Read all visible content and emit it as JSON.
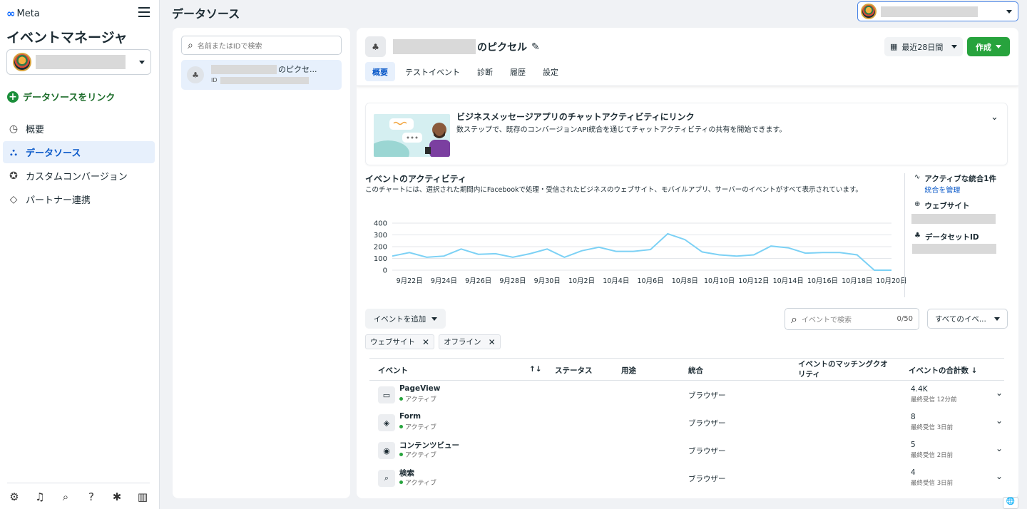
{
  "sidebar": {
    "logo": "Meta",
    "app_title": "イベントマネージャ",
    "link_datasource": "データソースをリンク",
    "nav": [
      {
        "label": "概要",
        "icon": "gauge-icon"
      },
      {
        "label": "データソース",
        "icon": "datasource-icon",
        "active": true
      },
      {
        "label": "カスタムコンバージョン",
        "icon": "star-icon"
      },
      {
        "label": "パートナー連携",
        "icon": "handshake-icon"
      }
    ],
    "bottom_icons": [
      "gear-icon",
      "bell-icon",
      "search-icon",
      "help-icon",
      "bug-icon",
      "panel-icon"
    ]
  },
  "header": {
    "page_title": "データソース"
  },
  "list": {
    "search_placeholder": "名前またはIDで検索",
    "item_suffix": "のピクセ...",
    "item_id_label": "ID"
  },
  "main": {
    "title_suffix": "のピクセル",
    "date_range": "最近28日間",
    "create_label": "作成",
    "tabs": [
      "概要",
      "テストイベント",
      "診断",
      "履歴",
      "設定"
    ],
    "promo": {
      "title": "ビジネスメッセージアプリのチャットアクティビティにリンク",
      "desc": "数ステップで、既存のコンバージョンAPI統合を通じてチャットアクティビティの共有を開始できます。"
    },
    "activity": {
      "title": "イベントのアクティビティ",
      "desc": "このチャートには、選択された期間内にFacebookで処理・受信されたビジネスのウェブサイト、モバイルアプリ、サーバーのイベントがすべて表示されています。"
    },
    "side_info": {
      "integrations": "アクティブな統合1件",
      "manage_link": "統合を管理",
      "website_label": "ウェブサイト",
      "dataset_label": "データセットID"
    },
    "add_event": "イベントを追加",
    "event_search_placeholder": "イベントで検索",
    "event_search_count": "0/50",
    "all_events": "すべてのイベ...",
    "chips": [
      "ウェブサイト",
      "オフライン"
    ],
    "table": {
      "headers": {
        "event": "イベント",
        "sort": "↑↓",
        "status": "ステータス",
        "usage": "用途",
        "integration": "統合",
        "quality": "イベントのマッチングクオリティ",
        "total": "イベントの合計数 ↓"
      },
      "rows": [
        {
          "name": "PageView",
          "status": "アクティブ",
          "integration": "ブラウザー",
          "total": "4.4K",
          "last": "最終受信 12分前",
          "icon": "page-icon",
          "glyph": "▭"
        },
        {
          "name": "Form",
          "status": "アクティブ",
          "integration": "ブラウザー",
          "total": "8",
          "last": "最終受信 3日前",
          "icon": "tag-icon",
          "glyph": "◈"
        },
        {
          "name": "コンテンツビュー",
          "status": "アクティブ",
          "integration": "ブラウザー",
          "total": "5",
          "last": "最終受信 2日前",
          "icon": "eye-icon",
          "glyph": "◉"
        },
        {
          "name": "検索",
          "status": "アクティブ",
          "integration": "ブラウザー",
          "total": "4",
          "last": "最終受信 3日前",
          "icon": "search-icon",
          "glyph": "⌕"
        }
      ]
    }
  },
  "chart_data": {
    "type": "line",
    "x": [
      "9月21日",
      "9月22日",
      "9月23日",
      "9月24日",
      "9月25日",
      "9月26日",
      "9月27日",
      "9月28日",
      "9月29日",
      "9月30日",
      "10月1日",
      "10月2日",
      "10月3日",
      "10月4日",
      "10月5日",
      "10月6日",
      "10月7日",
      "10月8日",
      "10月9日",
      "10月10日",
      "10月11日",
      "10月12日",
      "10月13日",
      "10月14日",
      "10月15日",
      "10月16日",
      "10月17日",
      "10月18日",
      "10月19日",
      "10月20日"
    ],
    "tick_labels": [
      "9月22日",
      "9月24日",
      "9月26日",
      "9月28日",
      "9月30日",
      "10月2日",
      "10月4日",
      "10月6日",
      "10月8日",
      "10月10日",
      "10月12日",
      "10月14日",
      "10月16日",
      "10月18日",
      "10月20日"
    ],
    "values": [
      120,
      150,
      110,
      120,
      180,
      135,
      140,
      110,
      140,
      180,
      110,
      165,
      195,
      160,
      160,
      175,
      310,
      260,
      155,
      130,
      120,
      130,
      205,
      190,
      145,
      150,
      150,
      130,
      0,
      0
    ],
    "ylim": [
      0,
      400
    ],
    "yticks": [
      0,
      100,
      200,
      300,
      400
    ],
    "color": "#7cd1f5",
    "grid": true
  }
}
